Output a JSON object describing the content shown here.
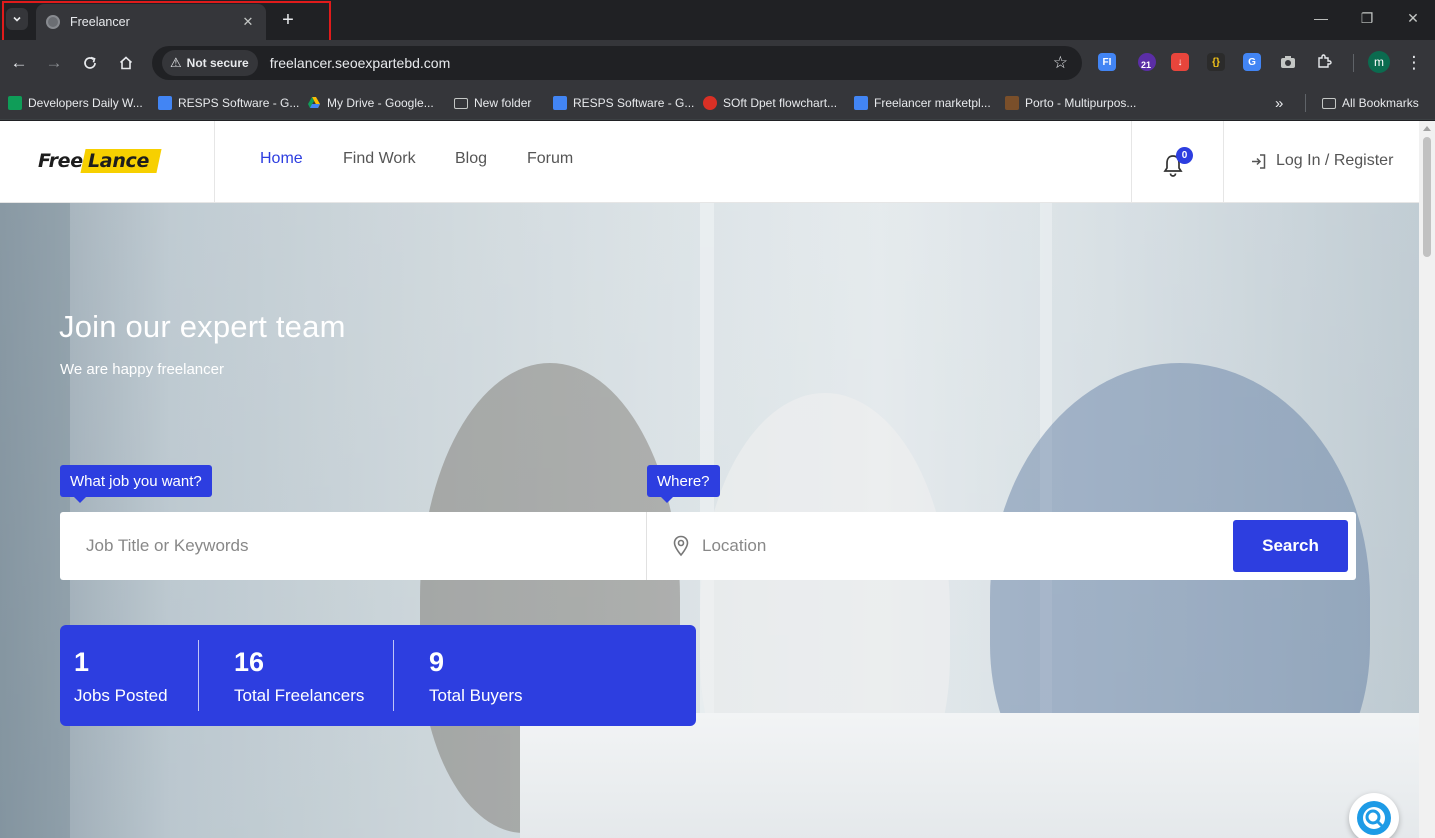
{
  "browser": {
    "tab": {
      "title": "Freelancer",
      "close": "✕"
    },
    "new_tab": "+",
    "security_chip": "Not secure",
    "url": "freelancer.seoexpartebd.com",
    "profile_initial": "m",
    "extension_badge": "21",
    "extension_fi": "FI",
    "bookmarks": [
      {
        "label": "Developers Daily W...",
        "icon": "sheets-icon"
      },
      {
        "label": "RESPS Software - G...",
        "icon": "docs-icon"
      },
      {
        "label": "My Drive - Google...",
        "icon": "drive-icon"
      },
      {
        "label": "New folder",
        "icon": "folder-icon"
      },
      {
        "label": "RESPS Software - G...",
        "icon": "docs-icon"
      },
      {
        "label": "SOft Dpet flowchart...",
        "icon": "flowchart-icon"
      },
      {
        "label": "Freelancer marketpl...",
        "icon": "docs-icon"
      },
      {
        "label": "Porto - Multipurpos...",
        "icon": "porto-icon"
      }
    ],
    "bookmarks_overflow": "»",
    "all_bookmarks": "All Bookmarks"
  },
  "site": {
    "logo": {
      "part1": "Free",
      "part2": "Lance"
    },
    "nav": [
      "Home",
      "Find Work",
      "Blog",
      "Forum"
    ],
    "active_nav": "Home",
    "notifications_count": "0",
    "login_label": "Log In / Register"
  },
  "hero": {
    "title": "Join our expert team",
    "subtitle": "We are happy freelancer",
    "job_tag": "What job you want?",
    "where_tag": "Where?",
    "job_placeholder": "Job Title or Keywords",
    "location_placeholder": "Location",
    "search_button": "Search"
  },
  "stats": [
    {
      "value": "1",
      "label": "Jobs Posted"
    },
    {
      "value": "16",
      "label": "Total Freelancers"
    },
    {
      "value": "9",
      "label": "Total Buyers"
    }
  ],
  "colors": {
    "brand_blue": "#2d3ee0",
    "logo_yellow": "#f7d000",
    "highlight_red": "#e01b1b"
  }
}
